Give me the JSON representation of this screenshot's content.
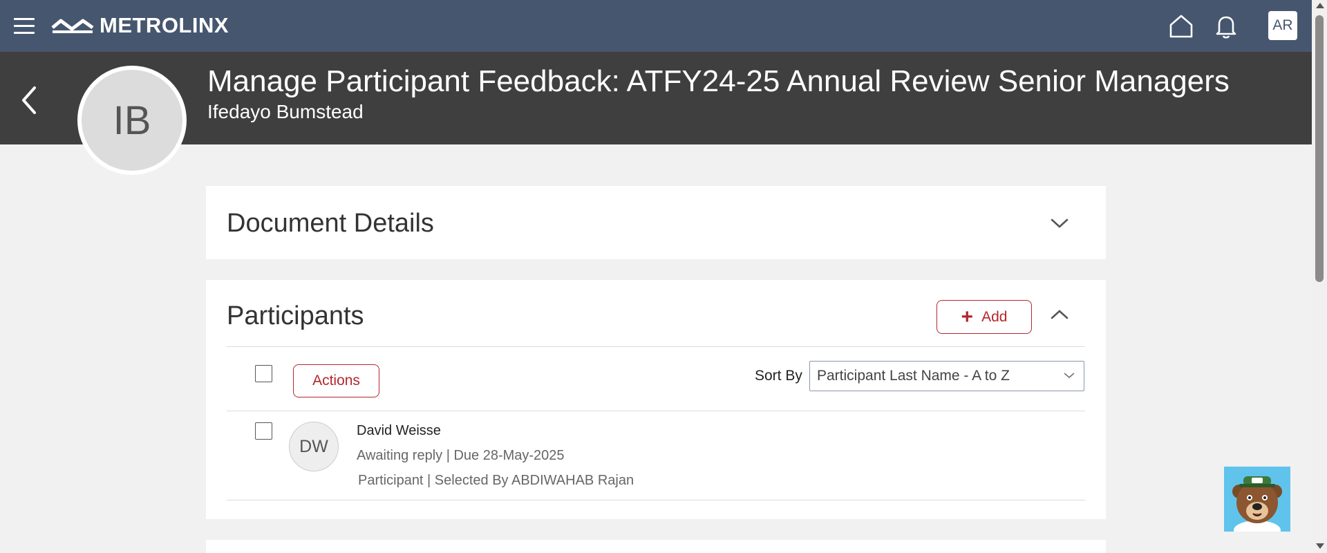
{
  "topbar": {
    "brand": "METROLINX",
    "user_initials": "AR",
    "bg_color": "#46566f"
  },
  "header": {
    "title": "Manage Participant Feedback: ATFY24-25 Annual Review Senior Managers",
    "subtitle": "Ifedayo Bumstead",
    "avatar_initials": "IB"
  },
  "document_details": {
    "title": "Document Details"
  },
  "participants": {
    "title": "Participants",
    "add_label": "Add",
    "actions_label": "Actions",
    "sort_label": "Sort By",
    "sort_value": "Participant Last Name - A to Z",
    "rows": [
      {
        "initials": "DW",
        "name": "David Weisse",
        "status": "Awaiting reply | Due 28-May-2025",
        "role": "Participant | Selected By ABDIWAHAB Rajan"
      }
    ]
  },
  "colors": {
    "accent": "#b5262d",
    "header_bg": "#3f3f3f"
  }
}
